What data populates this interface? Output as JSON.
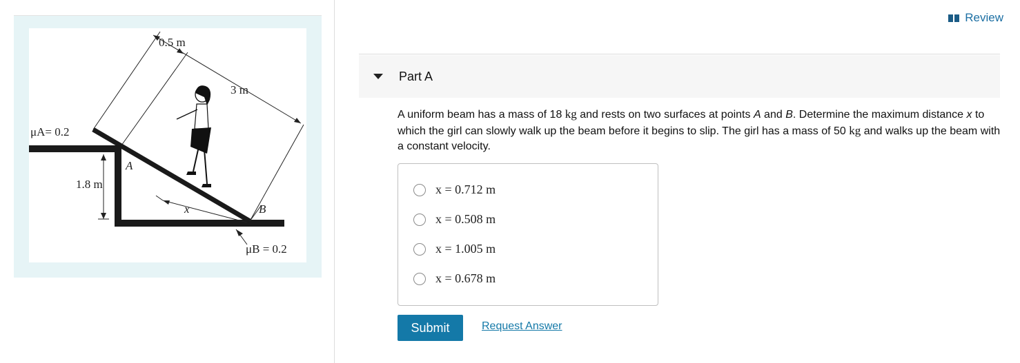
{
  "header": {
    "review_label": "Review"
  },
  "figure": {
    "labels": {
      "dim_top": "0.5 m",
      "dim_beam": "3 m",
      "mu_a": "μA= 0.2",
      "height": "1.8 m",
      "point_a": "A",
      "point_b": "B",
      "dim_x": "x",
      "mu_b": "μB = 0.2"
    }
  },
  "part": {
    "title": "Part A",
    "text_1": "A uniform beam has a mass of 18 ",
    "unit_kg": "kg",
    "text_2": " and rests on two surfaces at points ",
    "point_a": "A",
    "text_and": " and ",
    "point_b": "B",
    "text_3": ". Determine the maximum distance ",
    "var_x": "x",
    "text_4": " to which the girl can slowly walk up the beam before it begins to slip. The girl has a mass of 50 ",
    "text_5": " and walks up the beam with a constant velocity."
  },
  "options": [
    {
      "label": "x = 0.712 m"
    },
    {
      "label": "x = 0.508 m"
    },
    {
      "label": "x = 1.005 m"
    },
    {
      "label": "x = 0.678 m"
    }
  ],
  "actions": {
    "submit": "Submit",
    "request_answer": "Request Answer"
  }
}
